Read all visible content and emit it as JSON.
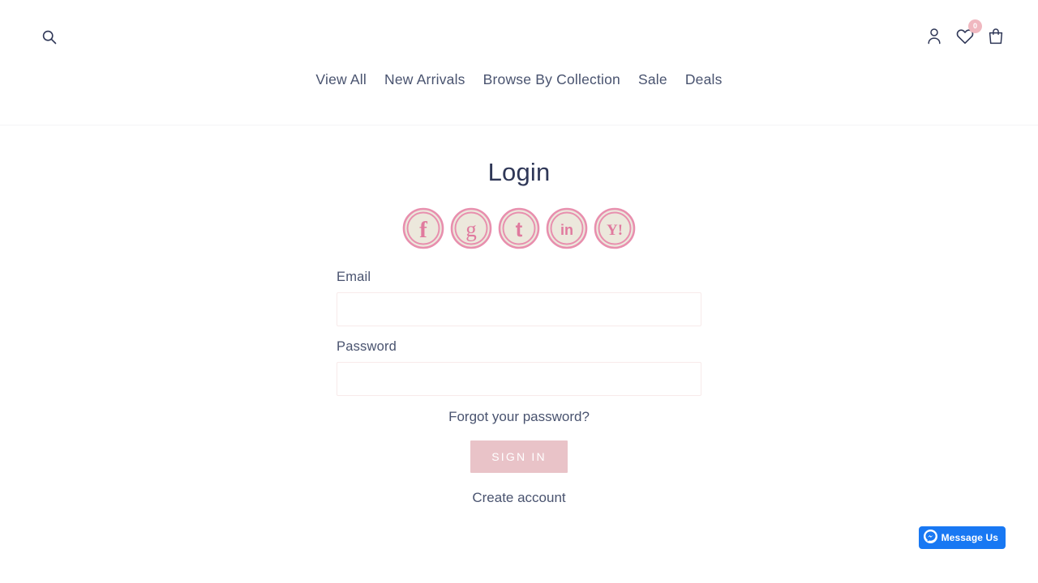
{
  "header": {
    "search_icon": "search-icon",
    "icons": [
      {
        "name": "account-icon",
        "label": "Account"
      },
      {
        "name": "wishlist-icon",
        "label": "Wishlist",
        "badge": "0"
      },
      {
        "name": "cart-icon",
        "label": "Cart"
      }
    ],
    "nav": [
      {
        "label": "View All"
      },
      {
        "label": "New Arrivals"
      },
      {
        "label": "Browse By Collection"
      },
      {
        "label": "Sale"
      },
      {
        "label": "Deals"
      }
    ]
  },
  "main": {
    "title": "Login",
    "social_logins": [
      {
        "name": "facebook-icon",
        "glyph": "f"
      },
      {
        "name": "google-icon",
        "glyph": "g"
      },
      {
        "name": "twitter-icon",
        "glyph": "t"
      },
      {
        "name": "linkedin-icon",
        "glyph": "in"
      },
      {
        "name": "yahoo-icon",
        "glyph": "Y!"
      }
    ],
    "email": {
      "label": "Email",
      "value": "",
      "placeholder": ""
    },
    "password": {
      "label": "Password",
      "value": "",
      "placeholder": ""
    },
    "forgot_link": "Forgot your password?",
    "signin_button": "SIGN IN",
    "create_link": "Create account"
  },
  "messenger": {
    "label": "Message Us",
    "icon": "messenger-icon"
  },
  "colors": {
    "text": "#49536f",
    "title": "#2f3757",
    "accent_pink": "#e9c3c8",
    "social_pink": "#e489a8",
    "badge_pink": "#f0b8c0",
    "input_border": "#f8eaea",
    "messenger_blue": "#1878f3"
  }
}
